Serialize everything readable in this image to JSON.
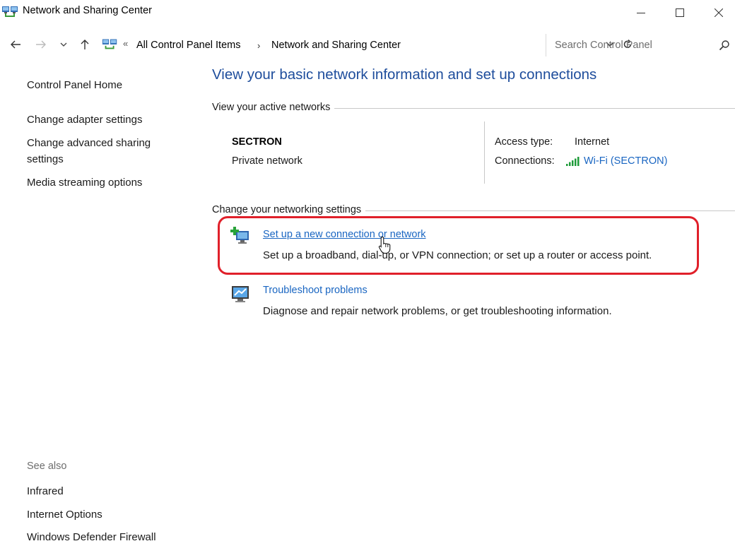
{
  "window": {
    "title": "Network and Sharing Center"
  },
  "address": {
    "crumbs": [
      "All Control Panel Items",
      "Network and Sharing Center"
    ],
    "overflow_glyph": "«",
    "separator_glyph": "›"
  },
  "search": {
    "placeholder": "Search Control Panel"
  },
  "left_pane": {
    "home": "Control Panel Home",
    "links": [
      "Change adapter settings",
      "Change advanced sharing",
      "settings",
      "Media streaming options"
    ],
    "see_also_title": "See also",
    "see_also": [
      "Infrared",
      "Internet Options",
      "Windows Defender Firewall"
    ]
  },
  "main": {
    "title": "View your basic network information and set up connections",
    "active_networks_heading": "View your active networks",
    "network": {
      "name": "SECTRON",
      "type": "Private network",
      "access_type_label": "Access type:",
      "access_type_value": "Internet",
      "connections_label": "Connections:",
      "connections_value": "Wi-Fi (SECTRON)"
    },
    "settings_heading": "Change your networking settings",
    "tasks": [
      {
        "link": "Set up a new connection or network",
        "desc": "Set up a broadband, dial-up, or VPN connection; or set up a router or access point."
      },
      {
        "link": "Troubleshoot problems",
        "desc": "Diagnose and repair network problems, or get troubleshooting information."
      }
    ]
  },
  "colors": {
    "title_blue": "#1e4d9c",
    "link_blue": "#1a66c2",
    "highlight_red": "#e0202a",
    "wifi_green": "#1f9b3a"
  }
}
